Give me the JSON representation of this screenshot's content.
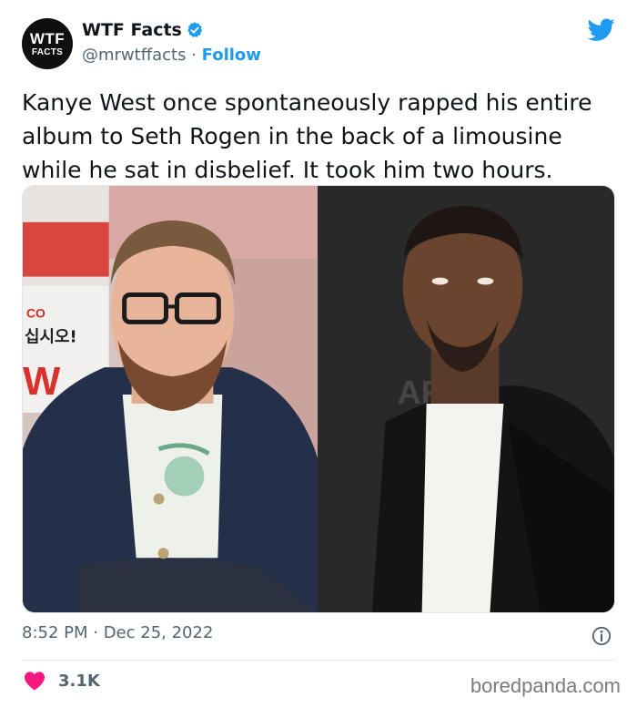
{
  "author": {
    "avatar_line1": "WTF",
    "avatar_line2": "FACTS",
    "display_name": "WTF Facts",
    "handle": "@mrwtffacts",
    "separator": " · ",
    "follow_label": "Follow",
    "verified": true
  },
  "tweet": {
    "text": "Kanye West once spontaneously rapped his entire album to Seth Rogen in the back of a limousine while he sat in disbelief. It took him two hours.",
    "timestamp": "8:52 PM · Dec 25, 2022"
  },
  "media": {
    "left_photo_sign_text": [
      "CO",
      "십시오!",
      "W"
    ],
    "right_photo_backdrop_text": "AR"
  },
  "engagement": {
    "likes": "3.1K"
  },
  "watermark": "boredpanda.com",
  "colors": {
    "accent": "#1d9bf0",
    "like": "#f91880",
    "text": "#0f1419",
    "muted": "#536471"
  },
  "icons": [
    "verified-badge-icon",
    "twitter-bird-icon",
    "info-icon",
    "heart-icon"
  ]
}
